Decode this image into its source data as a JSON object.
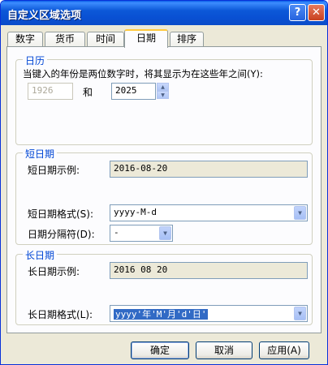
{
  "window": {
    "title": "自定义区域选项",
    "help_label": "?",
    "close_label": "✕"
  },
  "tabs": [
    {
      "label": "数字"
    },
    {
      "label": "货币"
    },
    {
      "label": "时间"
    },
    {
      "label": "日期",
      "active": true
    },
    {
      "label": "排序"
    }
  ],
  "calendar": {
    "legend": "日历",
    "description": "当键入的年份是两位数字时，将其显示为在这些年之间(Y):",
    "year_from": "1926",
    "and_label": "和",
    "year_to": "2025"
  },
  "short_date": {
    "legend": "短日期",
    "example_label": "短日期示例:",
    "example_value": "2016-08-20",
    "format_label": "短日期格式(S):",
    "format_value": "yyyy-M-d",
    "separator_label": "日期分隔符(D):",
    "separator_value": "-"
  },
  "long_date": {
    "legend": "长日期",
    "example_label": "长日期示例:",
    "example_value": "2016 08 20",
    "format_label": "长日期格式(L):",
    "format_value": "yyyy'年'M'月'd'日'"
  },
  "buttons": {
    "ok": "确定",
    "cancel": "取消",
    "apply": "应用(A)"
  },
  "colors": {
    "titlebar": "#0a58d8",
    "legend": "#0046d5",
    "panel": "#fcfcfe",
    "window": "#ece9d8"
  }
}
